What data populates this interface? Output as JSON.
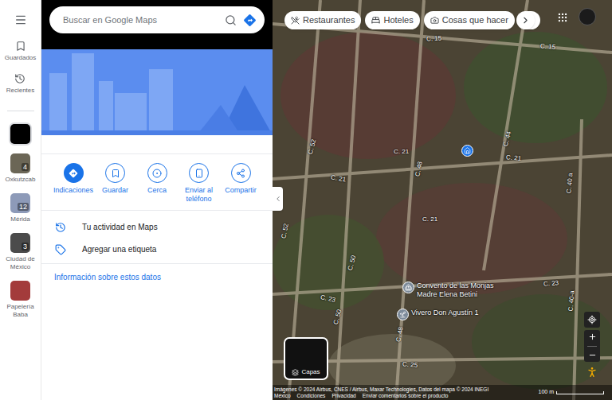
{
  "search": {
    "placeholder": "Buscar en Google Maps"
  },
  "rail": {
    "nav": [
      {
        "label": "Guardados"
      },
      {
        "label": "Recientes"
      }
    ],
    "places": [
      {
        "label": "",
        "count": "",
        "selected": true,
        "color": "#000000"
      },
      {
        "label": "Oxkutzcab",
        "count": "4",
        "selected": false,
        "color": "#6b6656"
      },
      {
        "label": "Mérida",
        "count": "12",
        "selected": false,
        "color": "#8d9ab8"
      },
      {
        "label": "Ciudad de México",
        "count": "3",
        "selected": false,
        "color": "#4b4b4b"
      },
      {
        "label": "Papelería Baba",
        "count": "",
        "selected": false,
        "color": "#a33b3b"
      }
    ]
  },
  "actions": [
    {
      "label": "Indicaciones",
      "kind": "primary"
    },
    {
      "label": "Guardar",
      "kind": "save"
    },
    {
      "label": "Cerca",
      "kind": "nearby"
    },
    {
      "label": "Enviar al teléfono",
      "kind": "phone"
    },
    {
      "label": "Compartir",
      "kind": "share"
    }
  ],
  "links": [
    {
      "label": "Tu actividad en Maps",
      "kind": "history"
    },
    {
      "label": "Agregar una etiqueta",
      "kind": "label"
    }
  ],
  "info_link": "Información sobre estos datos",
  "chips": [
    {
      "label": "Restaurantes",
      "kind": "food"
    },
    {
      "label": "Hoteles",
      "kind": "hotel"
    },
    {
      "label": "Cosas que hacer",
      "kind": "things"
    },
    {
      "label": "",
      "kind": "transit"
    }
  ],
  "streets": [
    "C. 15",
    "C. 15",
    "C. 52",
    "C. 48",
    "C. 21",
    "C. 21",
    "C. 21",
    "C. 21",
    "C. 44",
    "C. 40 a",
    "C. 52",
    "C. 50",
    "C. 23",
    "C. 50",
    "C. 23",
    "C. 40-a",
    "C. 48",
    "C. 25"
  ],
  "places": [
    {
      "lines": [
        "Convento de las Monjas",
        "Madre Elena Betini"
      ],
      "kind": "church"
    },
    {
      "lines": [
        "Vivero Don Agustín 1"
      ],
      "kind": "nursery"
    }
  ],
  "layers": {
    "label": "Capas"
  },
  "attribution": "Imágenes © 2024 Airbus, CNES / Airbus, Maxar Technologies, Datos del mapa © 2024 INEGI",
  "footer_links": [
    "México",
    "Condiciones",
    "Privacidad",
    "Enviar comentarios sobre el producto"
  ],
  "scale": "100 m"
}
